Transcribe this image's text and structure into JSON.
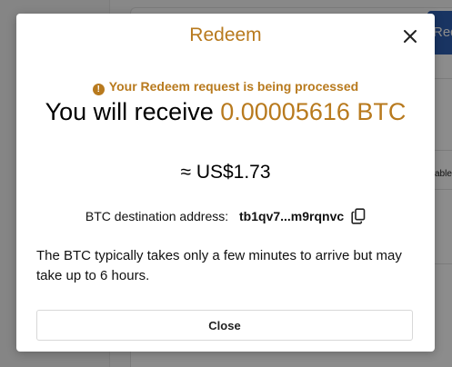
{
  "background": {
    "button_label": "Redeem",
    "side_text": "able"
  },
  "modal": {
    "title": "Redeem",
    "status_icon": "!",
    "status_text": "Your Redeem request is being processed",
    "receive_prefix": "You will receive",
    "receive_amount": "0.00005616 BTC",
    "usd_value": "≈ US$1.73",
    "destination_label": "BTC destination address:",
    "destination_address": "tb1qv7...m9rqnvc",
    "note": "The BTC typically takes only a few minutes to arrive but may take up to 6 hours.",
    "close_label": "Close"
  },
  "colors": {
    "accent": "#b87a1e",
    "overlay": "rgba(0,0,0,0.45)",
    "background_button": "#2f5fb3"
  },
  "icons": {
    "close": "close-icon",
    "status": "warning-circle-icon",
    "copy": "copy-icon"
  }
}
